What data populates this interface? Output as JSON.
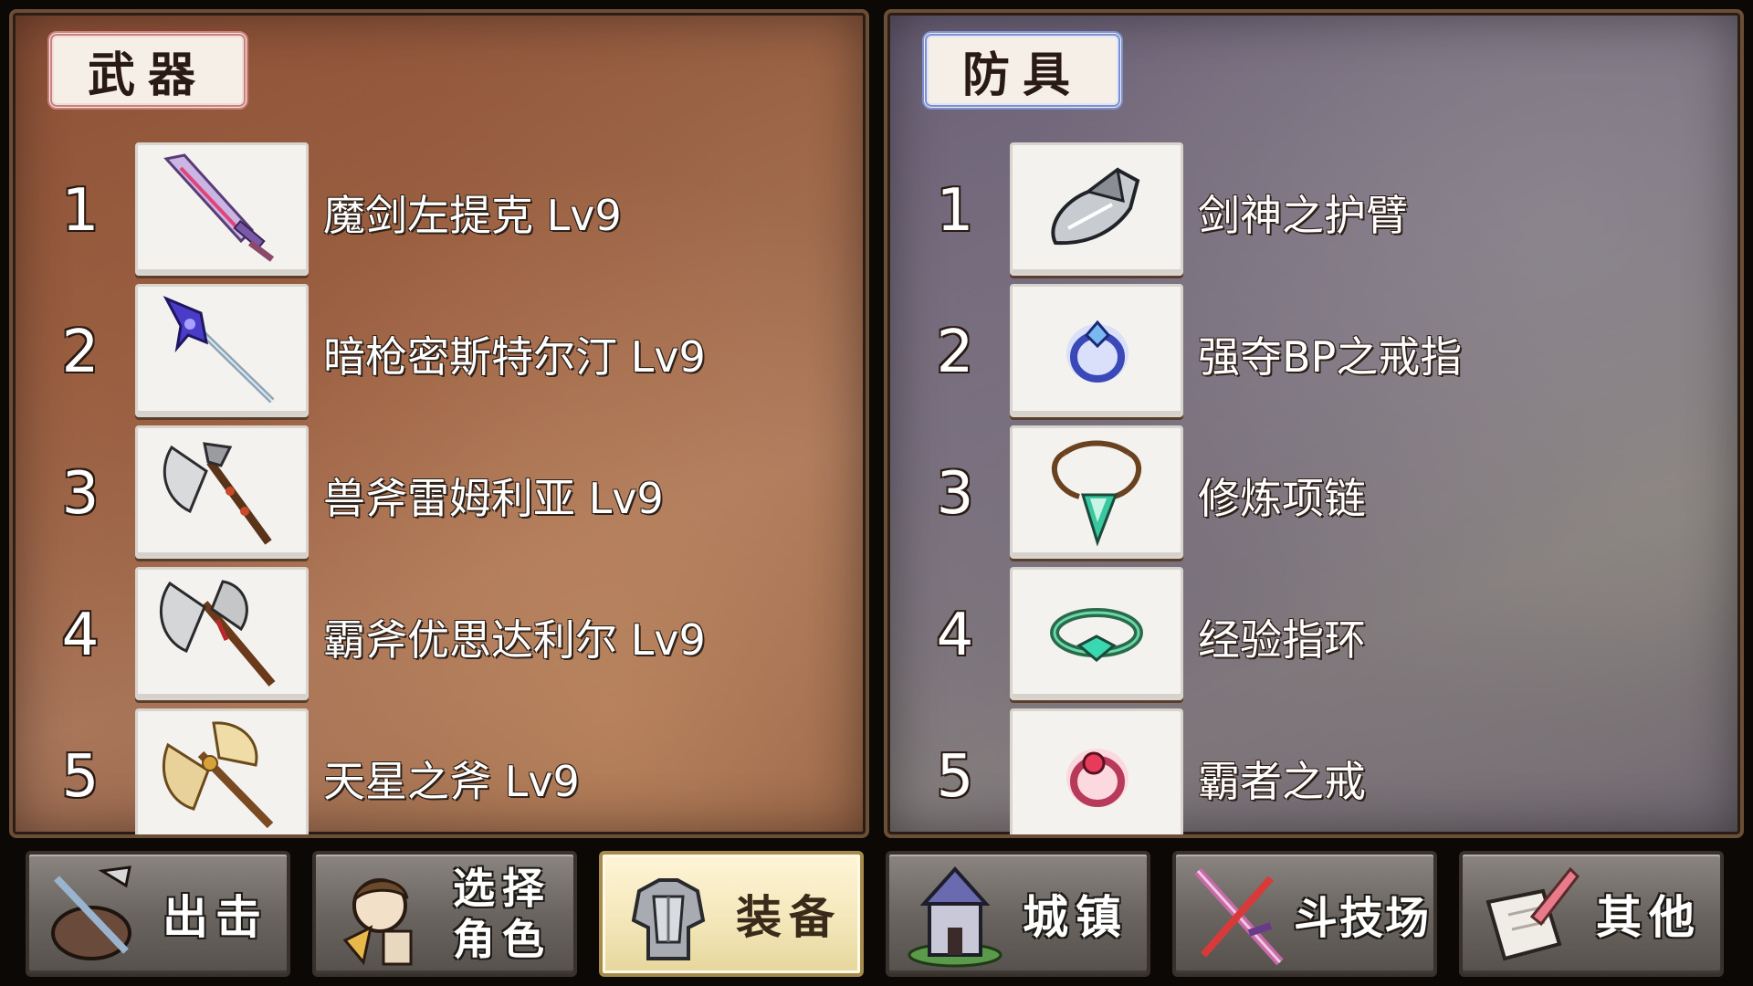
{
  "weapons_panel": {
    "title": "武器",
    "items": [
      {
        "rank": "1",
        "name": "魔剑左提克 Lv9",
        "icon": "purple-sword-icon"
      },
      {
        "rank": "2",
        "name": "暗枪密斯特尔汀 Lv9",
        "icon": "dark-spear-icon"
      },
      {
        "rank": "3",
        "name": "兽斧雷姆利亚 Lv9",
        "icon": "beast-axe-icon"
      },
      {
        "rank": "4",
        "name": "霸斧优思达利尔 Lv9",
        "icon": "battle-axe-icon"
      },
      {
        "rank": "5",
        "name": "天星之斧 Lv9",
        "icon": "golden-axe-icon"
      }
    ]
  },
  "armor_panel": {
    "title": "防具",
    "items": [
      {
        "rank": "1",
        "name": "剑神之护臂",
        "icon": "gauntlet-icon"
      },
      {
        "rank": "2",
        "name": "强夺BP之戒指",
        "icon": "blue-ring-icon"
      },
      {
        "rank": "3",
        "name": "修炼项链",
        "icon": "necklace-icon"
      },
      {
        "rank": "4",
        "name": "经验指环",
        "icon": "green-ring-icon"
      },
      {
        "rank": "5",
        "name": "霸者之戒",
        "icon": "red-ring-icon"
      }
    ]
  },
  "nav": {
    "sortie": {
      "label": "出击",
      "icon": "sortie-icon"
    },
    "select_character": {
      "label_line1": "选择",
      "label_line2": "角色",
      "icon": "character-icon"
    },
    "equipment": {
      "label": "装备",
      "icon": "armor-icon",
      "active": true
    },
    "town": {
      "label": "城镇",
      "icon": "town-icon"
    },
    "arena": {
      "label": "斗技场",
      "icon": "arena-sword-icon"
    },
    "other": {
      "label": "其他",
      "icon": "scroll-quill-icon"
    }
  },
  "colors": {
    "weapons_tag_border": "#c9807a",
    "armor_tag_border": "#7c90cf",
    "active_button": "#f2e6b8"
  }
}
